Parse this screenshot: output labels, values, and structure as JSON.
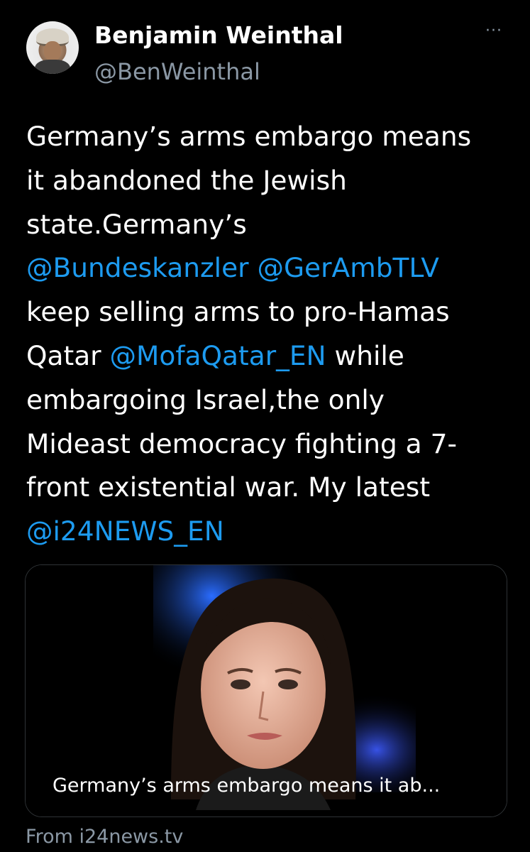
{
  "author": {
    "display_name": "Benjamin Weinthal",
    "handle": "@BenWeinthal",
    "avatar_icon": "profile-avatar"
  },
  "more_icon": "···",
  "tweet_lines": [
    [
      {
        "text": "Germany’s arms embargo means",
        "mention": false
      }
    ],
    [
      {
        "text": "it abandoned the Jewish",
        "mention": false
      }
    ],
    [
      {
        "text": "state.Germany’s",
        "mention": false
      }
    ],
    [
      {
        "text": "@Bundeskanzler",
        "mention": true
      },
      {
        "text": " ",
        "mention": false
      },
      {
        "text": "@GerAmbTLV",
        "mention": true
      }
    ],
    [
      {
        "text": "keep selling arms to pro-Hamas",
        "mention": false
      }
    ],
    [
      {
        "text": "Qatar ",
        "mention": false
      },
      {
        "text": "@MofaQatar_EN",
        "mention": true
      },
      {
        "text": "  while",
        "mention": false
      }
    ],
    [
      {
        "text": "embargoing Israel,the only",
        "mention": false
      }
    ],
    [
      {
        "text": "Mideast democracy fighting a 7-",
        "mention": false
      }
    ],
    [
      {
        "text": "front existential war. My latest",
        "mention": false
      }
    ],
    [
      {
        "text": "@i24NEWS_EN",
        "mention": true
      }
    ]
  ],
  "link_card": {
    "caption": "Germany’s arms embargo means it ab...",
    "source": "From i24news.tv"
  },
  "colors": {
    "background": "#000000",
    "text": "#ffffff",
    "secondary": "#8b98a5",
    "link": "#1d9bf0",
    "card_border": "#2f3336"
  }
}
